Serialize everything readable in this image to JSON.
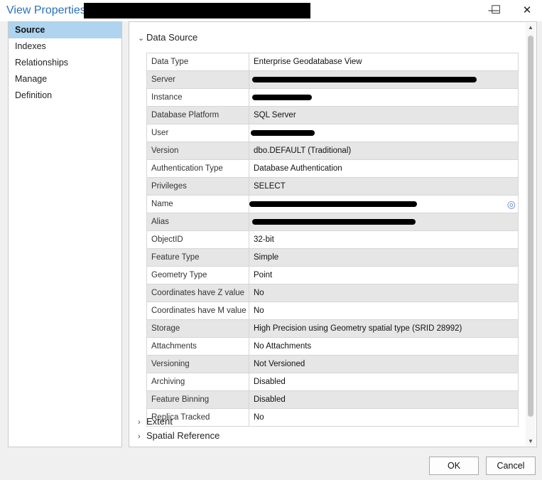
{
  "window": {
    "title": "View Properties",
    "minimize_glyph": "—",
    "maximize_glyph": "☐",
    "close_glyph": "✕"
  },
  "sidebar": {
    "items": [
      {
        "label": "Source",
        "active": true
      },
      {
        "label": "Indexes"
      },
      {
        "label": "Relationships"
      },
      {
        "label": "Manage"
      },
      {
        "label": "Definition"
      }
    ]
  },
  "sections": {
    "data_source": {
      "label": "Data Source",
      "expanded": true
    },
    "extent": {
      "label": "Extent",
      "expanded": false
    },
    "spatial_reference": {
      "label": "Spatial Reference",
      "expanded": false
    }
  },
  "properties": [
    {
      "key": "Data Type",
      "value": "Enterprise Geodatabase View"
    },
    {
      "key": "Server",
      "value": ""
    },
    {
      "key": "Instance",
      "value": ""
    },
    {
      "key": "Database Platform",
      "value": "SQL Server"
    },
    {
      "key": "User",
      "value": ""
    },
    {
      "key": "Version",
      "value": "dbo.DEFAULT (Traditional)"
    },
    {
      "key": "Authentication Type",
      "value": "Database Authentication"
    },
    {
      "key": "Privileges",
      "value": "SELECT"
    },
    {
      "key": "Name",
      "value": ""
    },
    {
      "key": "Alias",
      "value": ""
    },
    {
      "key": "ObjectID",
      "value": "32-bit"
    },
    {
      "key": "Feature Type",
      "value": "Simple"
    },
    {
      "key": "Geometry Type",
      "value": "Point"
    },
    {
      "key": "Coordinates have Z value",
      "value": "No"
    },
    {
      "key": "Coordinates have M value",
      "value": "No"
    },
    {
      "key": "Storage",
      "value": "High Precision using Geometry spatial type (SRID 28992)"
    },
    {
      "key": "Attachments",
      "value": "No Attachments"
    },
    {
      "key": "Versioning",
      "value": "Not Versioned"
    },
    {
      "key": "Archiving",
      "value": "Disabled"
    },
    {
      "key": "Feature Binning",
      "value": "Disabled"
    },
    {
      "key": "Replica Tracked",
      "value": "No"
    }
  ],
  "icons": {
    "expanded": "⌄",
    "collapsed": "›",
    "locate": "◎",
    "scroll_up": "▲",
    "scroll_down": "▼"
  },
  "buttons": {
    "ok": "OK",
    "cancel": "Cancel"
  },
  "colors": {
    "title": "#2a72b8",
    "selected_nav": "#aed4ef"
  }
}
